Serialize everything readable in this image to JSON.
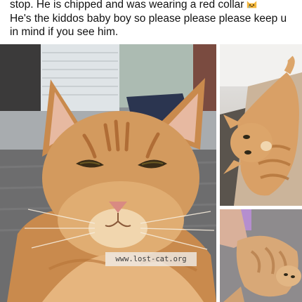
{
  "post": {
    "lines": [
      "stop. He is chipped and was wearing a red collar",
      "He's the kiddos baby boy so please please please keep u",
      "in mind if you see him."
    ],
    "emoji_icon": "crying-cat-emoji"
  },
  "photos": {
    "main": {
      "subject": "orange tabby cat selfie on bed",
      "icon": "cat-photo"
    },
    "top_right": {
      "subject": "orange tabby cat lying on couch",
      "icon": "cat-photo"
    },
    "bottom_right": {
      "subject": "orange tabby cat on carpet with child",
      "icon": "cat-photo"
    }
  },
  "watermark": {
    "text": "www.lost-cat.org"
  },
  "colors": {
    "fur_orange": "#d39a5e",
    "fur_dark": "#b87438",
    "fur_light": "#f1d6ae",
    "text": "#111111"
  }
}
